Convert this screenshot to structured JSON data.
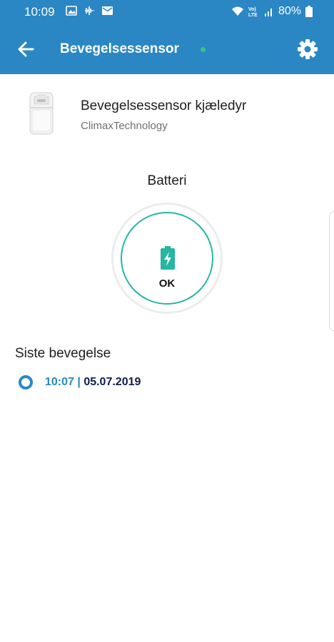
{
  "status_bar": {
    "time": "10:09",
    "battery_percent": "80%",
    "icons": [
      "image-icon",
      "voicemail-icon",
      "mail-icon",
      "wifi-icon",
      "volte-icon",
      "signal-icon",
      "battery-icon"
    ]
  },
  "app_bar": {
    "title": "Bevegelsessensor",
    "online": true,
    "icons": [
      "back-arrow-icon",
      "settings-gear-icon"
    ],
    "colors": {
      "bar": "#2a87c3",
      "online_dot": "#35c389"
    }
  },
  "device": {
    "name": "Bevegelsessensor kjæledyr",
    "manufacturer": "ClimaxTechnology"
  },
  "battery": {
    "label": "Batteri",
    "status": "OK",
    "colors": {
      "ring": "#26b6a2",
      "icon": "#26b6a2"
    }
  },
  "last_motion": {
    "title": "Siste bevegelse",
    "time": "10:07",
    "separator": "|",
    "date": "05.07.2019"
  }
}
